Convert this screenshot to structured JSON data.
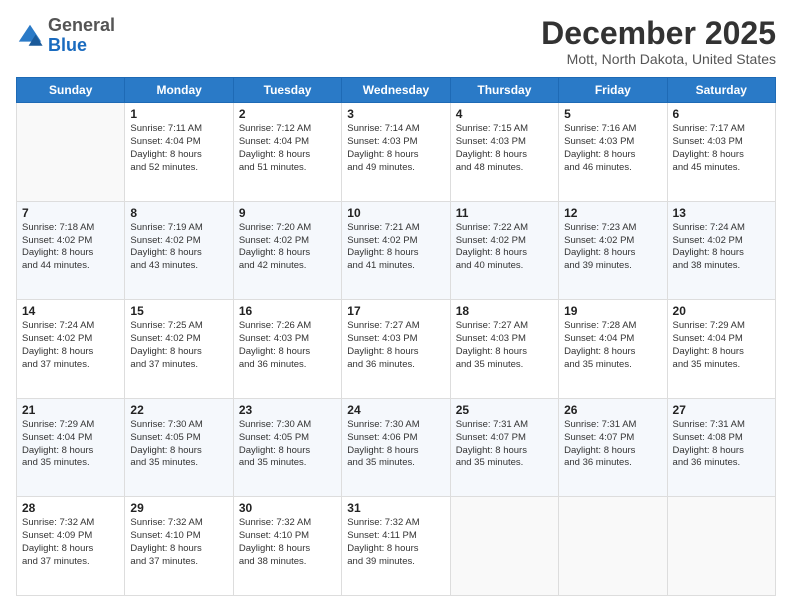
{
  "logo": {
    "line1": "General",
    "line2": "Blue"
  },
  "header": {
    "month": "December 2025",
    "location": "Mott, North Dakota, United States"
  },
  "weekdays": [
    "Sunday",
    "Monday",
    "Tuesday",
    "Wednesday",
    "Thursday",
    "Friday",
    "Saturday"
  ],
  "weeks": [
    [
      {
        "day": "",
        "info": ""
      },
      {
        "day": "1",
        "info": "Sunrise: 7:11 AM\nSunset: 4:04 PM\nDaylight: 8 hours\nand 52 minutes."
      },
      {
        "day": "2",
        "info": "Sunrise: 7:12 AM\nSunset: 4:04 PM\nDaylight: 8 hours\nand 51 minutes."
      },
      {
        "day": "3",
        "info": "Sunrise: 7:14 AM\nSunset: 4:03 PM\nDaylight: 8 hours\nand 49 minutes."
      },
      {
        "day": "4",
        "info": "Sunrise: 7:15 AM\nSunset: 4:03 PM\nDaylight: 8 hours\nand 48 minutes."
      },
      {
        "day": "5",
        "info": "Sunrise: 7:16 AM\nSunset: 4:03 PM\nDaylight: 8 hours\nand 46 minutes."
      },
      {
        "day": "6",
        "info": "Sunrise: 7:17 AM\nSunset: 4:03 PM\nDaylight: 8 hours\nand 45 minutes."
      }
    ],
    [
      {
        "day": "7",
        "info": "Sunrise: 7:18 AM\nSunset: 4:02 PM\nDaylight: 8 hours\nand 44 minutes."
      },
      {
        "day": "8",
        "info": "Sunrise: 7:19 AM\nSunset: 4:02 PM\nDaylight: 8 hours\nand 43 minutes."
      },
      {
        "day": "9",
        "info": "Sunrise: 7:20 AM\nSunset: 4:02 PM\nDaylight: 8 hours\nand 42 minutes."
      },
      {
        "day": "10",
        "info": "Sunrise: 7:21 AM\nSunset: 4:02 PM\nDaylight: 8 hours\nand 41 minutes."
      },
      {
        "day": "11",
        "info": "Sunrise: 7:22 AM\nSunset: 4:02 PM\nDaylight: 8 hours\nand 40 minutes."
      },
      {
        "day": "12",
        "info": "Sunrise: 7:23 AM\nSunset: 4:02 PM\nDaylight: 8 hours\nand 39 minutes."
      },
      {
        "day": "13",
        "info": "Sunrise: 7:24 AM\nSunset: 4:02 PM\nDaylight: 8 hours\nand 38 minutes."
      }
    ],
    [
      {
        "day": "14",
        "info": "Sunrise: 7:24 AM\nSunset: 4:02 PM\nDaylight: 8 hours\nand 37 minutes."
      },
      {
        "day": "15",
        "info": "Sunrise: 7:25 AM\nSunset: 4:02 PM\nDaylight: 8 hours\nand 37 minutes."
      },
      {
        "day": "16",
        "info": "Sunrise: 7:26 AM\nSunset: 4:03 PM\nDaylight: 8 hours\nand 36 minutes."
      },
      {
        "day": "17",
        "info": "Sunrise: 7:27 AM\nSunset: 4:03 PM\nDaylight: 8 hours\nand 36 minutes."
      },
      {
        "day": "18",
        "info": "Sunrise: 7:27 AM\nSunset: 4:03 PM\nDaylight: 8 hours\nand 35 minutes."
      },
      {
        "day": "19",
        "info": "Sunrise: 7:28 AM\nSunset: 4:04 PM\nDaylight: 8 hours\nand 35 minutes."
      },
      {
        "day": "20",
        "info": "Sunrise: 7:29 AM\nSunset: 4:04 PM\nDaylight: 8 hours\nand 35 minutes."
      }
    ],
    [
      {
        "day": "21",
        "info": "Sunrise: 7:29 AM\nSunset: 4:04 PM\nDaylight: 8 hours\nand 35 minutes."
      },
      {
        "day": "22",
        "info": "Sunrise: 7:30 AM\nSunset: 4:05 PM\nDaylight: 8 hours\nand 35 minutes."
      },
      {
        "day": "23",
        "info": "Sunrise: 7:30 AM\nSunset: 4:05 PM\nDaylight: 8 hours\nand 35 minutes."
      },
      {
        "day": "24",
        "info": "Sunrise: 7:30 AM\nSunset: 4:06 PM\nDaylight: 8 hours\nand 35 minutes."
      },
      {
        "day": "25",
        "info": "Sunrise: 7:31 AM\nSunset: 4:07 PM\nDaylight: 8 hours\nand 35 minutes."
      },
      {
        "day": "26",
        "info": "Sunrise: 7:31 AM\nSunset: 4:07 PM\nDaylight: 8 hours\nand 36 minutes."
      },
      {
        "day": "27",
        "info": "Sunrise: 7:31 AM\nSunset: 4:08 PM\nDaylight: 8 hours\nand 36 minutes."
      }
    ],
    [
      {
        "day": "28",
        "info": "Sunrise: 7:32 AM\nSunset: 4:09 PM\nDaylight: 8 hours\nand 37 minutes."
      },
      {
        "day": "29",
        "info": "Sunrise: 7:32 AM\nSunset: 4:10 PM\nDaylight: 8 hours\nand 37 minutes."
      },
      {
        "day": "30",
        "info": "Sunrise: 7:32 AM\nSunset: 4:10 PM\nDaylight: 8 hours\nand 38 minutes."
      },
      {
        "day": "31",
        "info": "Sunrise: 7:32 AM\nSunset: 4:11 PM\nDaylight: 8 hours\nand 39 minutes."
      },
      {
        "day": "",
        "info": ""
      },
      {
        "day": "",
        "info": ""
      },
      {
        "day": "",
        "info": ""
      }
    ]
  ]
}
